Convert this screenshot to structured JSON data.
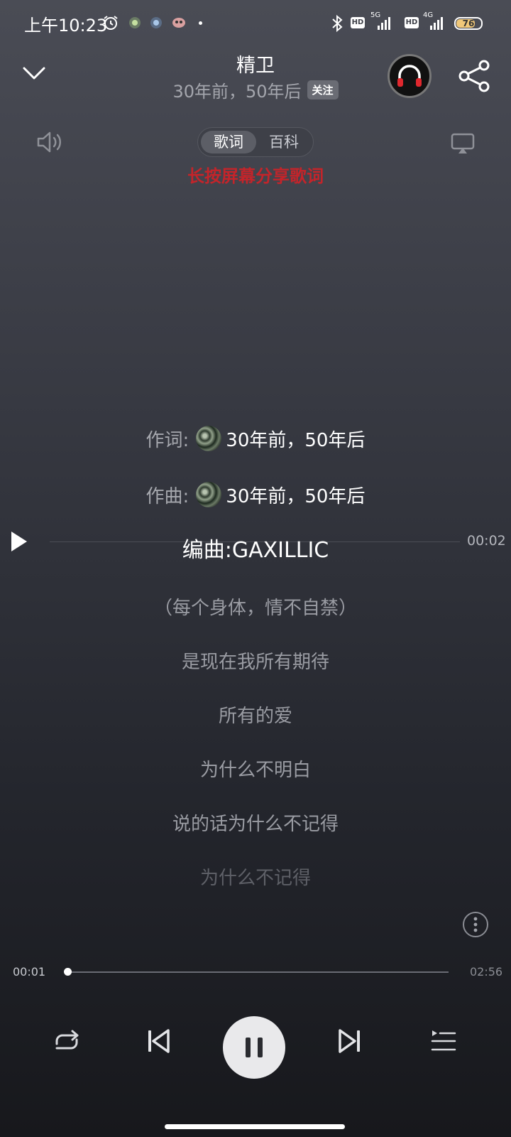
{
  "status_bar": {
    "time": "上午10:23",
    "network_1": "5G",
    "network_2": "4G",
    "hd_label": "HD",
    "battery": "76"
  },
  "header": {
    "title": "精卫",
    "artist": "30年前，50年后",
    "follow_label": "关注"
  },
  "tabs": {
    "lyrics": "歌词",
    "wiki": "百科"
  },
  "share_hint": "长按屏幕分享歌词",
  "credits": {
    "lyrics_key": "作词:",
    "lyrics_value": "30年前，50年后",
    "music_key": "作曲:",
    "music_value": "30年前，50年后"
  },
  "current_line": "编曲:GAXILLIC",
  "seek_time": "00:02",
  "lyrics": [
    "（每个身体，情不自禁）",
    "是现在我所有期待",
    "所有的爱",
    "为什么不明白",
    "说的话为什么不记得",
    "为什么不记得"
  ],
  "player": {
    "current_time": "00:01",
    "total_time": "02:56",
    "progress": 0.006
  },
  "colors": {
    "accent_hint": "#c4242a",
    "battery_fill": "#f0c87a"
  },
  "icons": [
    "alarm-icon",
    "bluetooth-icon",
    "collapse-chevron-icon",
    "headphone-icon",
    "share-icon",
    "volume-icon",
    "cast-icon",
    "play-icon",
    "more-icon",
    "repeat-icon",
    "previous-icon",
    "pause-icon",
    "next-icon",
    "playlist-icon"
  ]
}
